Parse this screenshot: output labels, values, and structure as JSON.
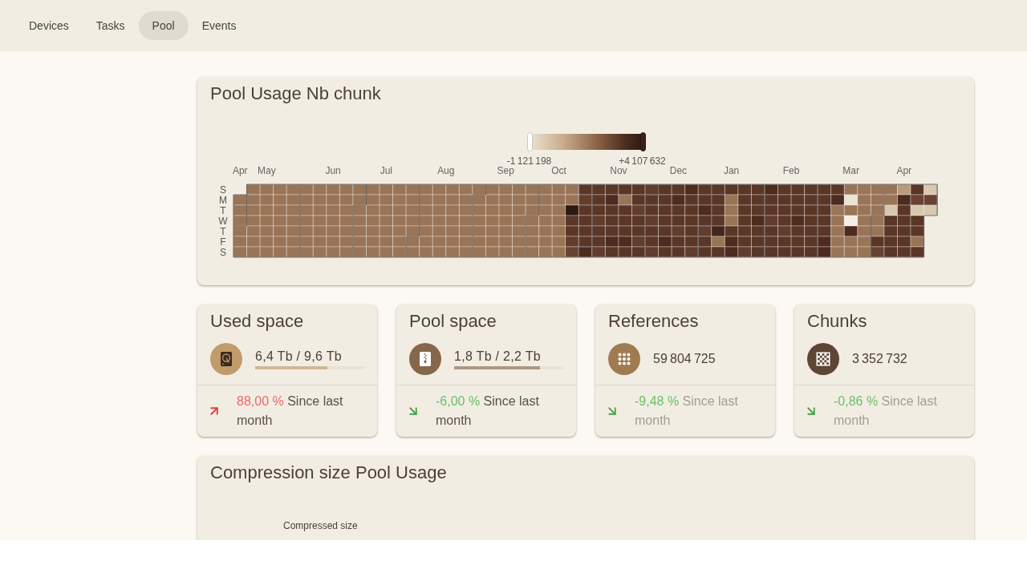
{
  "nav": {
    "tabs": [
      {
        "label": "Devices",
        "selected": false
      },
      {
        "label": "Tasks",
        "selected": false
      },
      {
        "label": "Pool",
        "selected": true
      },
      {
        "label": "Events",
        "selected": false
      }
    ]
  },
  "usage_heatmap": {
    "title": "Pool Usage Nb chunk",
    "legend": {
      "min": "-1 121 198",
      "max": "+4 107 632"
    },
    "months": [
      "Apr",
      "May",
      "Jun",
      "Jul",
      "Aug",
      "Sep",
      "Oct",
      "Nov",
      "Dec",
      "Jan",
      "Feb",
      "Mar",
      "Apr"
    ],
    "days": [
      "S",
      "M",
      "T",
      "W",
      "T",
      "F",
      "S"
    ]
  },
  "stats": [
    {
      "title": "Used space",
      "color": "#c19b6c",
      "value": "6,4 Tb / 9,6 Tb",
      "level": 0.66,
      "rising": true,
      "change": "88,00 %",
      "note": "Since last month",
      "dimmed": false
    },
    {
      "title": "Pool space",
      "color": "#86674b",
      "value": "1,8 Tb / 2,2 Tb",
      "level": 0.79,
      "rising": false,
      "change": "-6,00 %",
      "note": "Since last month",
      "dimmed": false
    },
    {
      "title": "References",
      "color": "#a07b51",
      "value": "59 804 725",
      "rising": false,
      "change": "-9,48 %",
      "note": "Since last month",
      "dimmed": true
    },
    {
      "title": "Chunks",
      "color": "#5e4535",
      "value": "3 352 732",
      "rising": false,
      "change": "-0,86 %",
      "note": "Since last month",
      "dimmed": true
    }
  ],
  "compression": {
    "title": "Compression size Pool Usage",
    "axis_title": "Compressed size"
  }
}
